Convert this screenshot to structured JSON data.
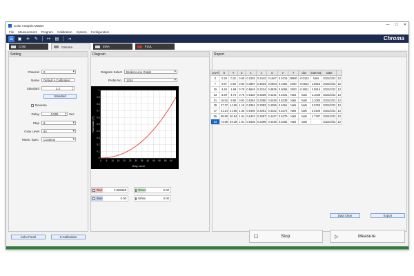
{
  "window": {
    "title": "Color Analysis Master",
    "controls": {
      "minimize": "—",
      "maximize": "☐",
      "close": "✕"
    }
  },
  "menu": [
    "File",
    "Measurement",
    "Program",
    "Calibration",
    "System",
    "Configuration"
  ],
  "brand": "Chroma",
  "tabs": [
    {
      "label": "Color",
      "active": false
    },
    {
      "label": "Gamma",
      "active": true
    },
    {
      "label": "EMA",
      "active": false
    },
    {
      "label": "FLVL",
      "active": false
    }
  ],
  "setting": {
    "title": "Setting",
    "channel_label": "Channel",
    "channel_value": "0",
    "name_label": "Name",
    "name_value": "Default A Calibration",
    "standard_label": "Standard",
    "standard_value": "2.2",
    "standard_button": "Standard",
    "reverse_label": "Reverse",
    "delay_label": "Delay",
    "delay_value": "0.500",
    "delay_unit": "Sec",
    "step_label": "Step",
    "step_value": "8",
    "gray_level_label": "Gray Level",
    "gray_level_value": "64",
    "meas_spec_label": "Meas. Spec.",
    "meas_spec_value": "Continue"
  },
  "diagram": {
    "title": "Diagram",
    "select_label": "Diagram Select",
    "select_value": "Broken-Line Graph",
    "probe_label": "Probe No.",
    "probe_value": "1234"
  },
  "chart_data": {
    "type": "line",
    "xlabel": "Gray Level",
    "ylabel": "Normalize (Y)",
    "xlim": [
      0,
      64
    ],
    "ylim": [
      0,
      1
    ],
    "x_ticks": [
      0,
      5,
      10,
      15,
      20,
      25,
      30,
      35,
      40,
      45,
      50,
      55,
      60
    ],
    "y_ticks": [
      0,
      0.1,
      0.2,
      0.3,
      0.4,
      0.5,
      0.6,
      0.7,
      0.8,
      0.9,
      1
    ],
    "grid": true,
    "series": [
      {
        "color": "#e53935",
        "x": [
          0,
          5,
          10,
          15,
          20,
          25,
          30,
          35,
          40,
          45,
          50,
          55,
          60,
          64
        ],
        "y": [
          0.0,
          0.004,
          0.017,
          0.04,
          0.074,
          0.119,
          0.176,
          0.245,
          0.326,
          0.42,
          0.527,
          0.647,
          0.781,
          0.9
        ]
      }
    ]
  },
  "color_boxes": [
    {
      "name": "Red",
      "value": "2.006968",
      "color": "#e53935"
    },
    {
      "name": "Green",
      "value": "0.00",
      "color": "#43a047"
    },
    {
      "name": "Blue",
      "value": "0.00",
      "color": "#1e88e5"
    },
    {
      "name": "White",
      "value": "0.00",
      "color": "#9e9e9e"
    }
  ],
  "report": {
    "title": "Report",
    "columns": [
      "Level",
      "X",
      "Y",
      "Z",
      "x",
      "y",
      "u'",
      "v'",
      "T",
      "duv",
      "Gamma",
      "Date",
      ""
    ],
    "rows": [
      [
        "0",
        "0.29",
        "0.31",
        "0.68",
        "0.2282",
        "0.2442",
        "0.1667",
        "0.4015",
        "29900",
        "-0.0163",
        "NaN",
        "2022/2/22",
        "12"
      ],
      [
        "7",
        "0.87",
        "0.62",
        "0.69",
        "0.3997",
        "0.2834",
        "0.2854",
        "0.4554",
        "2490",
        "-0.0522",
        "1.8923",
        "2022/2/22",
        "12"
      ],
      [
        "15",
        "3.48",
        "1.99",
        "0.79",
        "0.5645",
        "0.3224",
        "0.3935",
        "0.5055",
        "2000",
        "-0.0911",
        "2.0816",
        "2022/2/22",
        "12"
      ],
      [
        "23",
        "8.69",
        "4.73",
        "0.79",
        "0.6118",
        "0.3329",
        "0.4241",
        "0.5191",
        "NaN",
        "NaN",
        "2.1036",
        "2022/2/22",
        "12"
      ],
      [
        "31",
        "16.52",
        "8.85",
        "0.92",
        "0.6264",
        "0.3365",
        "0.4348",
        "0.5239",
        "NaN",
        "NaN",
        "2.1060",
        "2022/2/22",
        "12"
      ],
      [
        "39",
        "27.37",
        "14.55",
        "1.10",
        "0.6361",
        "0.3383",
        "0.4396",
        "0.5261",
        "NaN",
        "NaN",
        "2.0760",
        "2022/2/22",
        "12"
      ],
      [
        "47",
        "41.24",
        "21.85",
        "1.35",
        "0.6400",
        "0.3391",
        "0.4422",
        "0.5272",
        "NaN",
        "NaN",
        "2.0105",
        "2022/2/22",
        "12"
      ],
      [
        "55",
        "58.50",
        "30.94",
        "1.64",
        "0.6423",
        "0.3397",
        "0.4437",
        "0.5279",
        "NaN",
        "NaN",
        "1.7787",
        "2022/2/22",
        "12"
      ],
      [
        "63",
        "74.58",
        "39.39",
        "1.91",
        "0.6436",
        "0.3399",
        "0.4445",
        "0.5282",
        "NaN",
        "NaN",
        "",
        "2022/2/22",
        "12"
      ]
    ],
    "selected_row": 8,
    "data_clear_button": "Data Clear",
    "export_button": "Export"
  },
  "bottom": {
    "color_panel_button": "Color Panel",
    "s_calibration_button": "S-Calibration",
    "stop_button": "Stop",
    "measure_button": "Measure"
  }
}
